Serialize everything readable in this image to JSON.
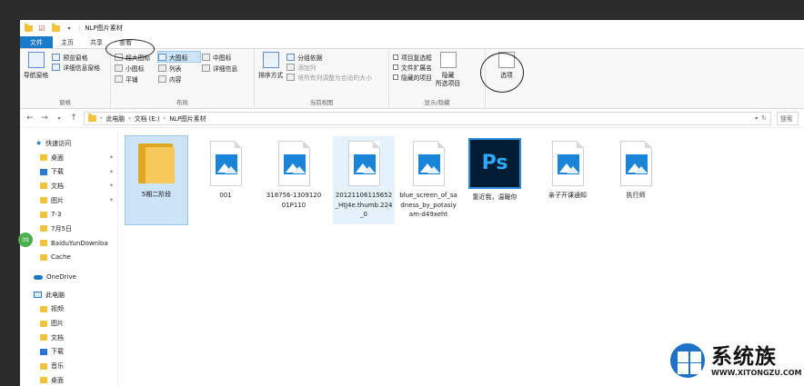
{
  "window": {
    "title": "NLP图片素材"
  },
  "tabs": [
    "文件",
    "主页",
    "共享",
    "查看"
  ],
  "ribbon": {
    "panes": {
      "nav_pane": "导航窗格",
      "preview_pane": "预览窗格",
      "details_pane": "详细信息窗格",
      "label": "窗格"
    },
    "layout": {
      "xl_icons": "超大图标",
      "large_icons": "大图标",
      "medium_icons": "中图标",
      "small_icons": "小图标",
      "list": "列表",
      "details": "详细信息",
      "tiles": "平铺",
      "content": "内容",
      "label": "布局"
    },
    "current_view": {
      "sort_by": "排序方式",
      "group_by": "分组依据",
      "add_columns": "添加列",
      "fit_columns": "将所有列调整为合适的大小",
      "label": "当前视图"
    },
    "show_hide": {
      "item_checkboxes": "项目复选框",
      "file_extensions": "文件扩展名",
      "hidden_items": "隐藏的项目",
      "hide_selected_1": "隐藏",
      "hide_selected_2": "所选项目",
      "label": "显示/隐藏"
    },
    "options": "选项"
  },
  "address": {
    "crumbs": [
      "此电脑",
      "文档 (E:)",
      "NLP图片素材"
    ],
    "search_placeholder": "搜索"
  },
  "nav": {
    "items": [
      {
        "label": "快速访问",
        "icon": "star-icon"
      },
      {
        "label": "桌面",
        "icon": "folder-icon"
      },
      {
        "label": "下载",
        "icon": "download-icon"
      },
      {
        "label": "文档",
        "icon": "folder-icon"
      },
      {
        "label": "图片",
        "icon": "folder-icon"
      },
      {
        "label": "7-3",
        "icon": "folder-icon"
      },
      {
        "label": "7月5日",
        "icon": "folder-icon"
      },
      {
        "label": "BaiduYunDownloa",
        "icon": "folder-icon"
      },
      {
        "label": "Cache",
        "icon": "folder-icon"
      },
      {
        "label": "OneDrive",
        "icon": "cloud-icon"
      },
      {
        "label": "此电脑",
        "icon": "pc-icon"
      },
      {
        "label": "视频",
        "icon": "folder-icon"
      },
      {
        "label": "图片",
        "icon": "folder-icon"
      },
      {
        "label": "文档",
        "icon": "folder-icon"
      },
      {
        "label": "下载",
        "icon": "download-icon"
      },
      {
        "label": "音乐",
        "icon": "folder-icon"
      },
      {
        "label": "桌面",
        "icon": "folder-icon"
      }
    ]
  },
  "files": [
    {
      "name": "5期二阶段",
      "type": "folder"
    },
    {
      "name": "001",
      "type": "image"
    },
    {
      "name": "318756-130912001P110",
      "type": "image"
    },
    {
      "name": "20121106115652_HtJ4e.thumb.224_0",
      "type": "image"
    },
    {
      "name": "blue_screen_of_sadness_by_potasiyam-d49xeht",
      "type": "image"
    },
    {
      "name": "靠近我，温暖你",
      "type": "psd"
    },
    {
      "name": "亲子开课通知",
      "type": "image"
    },
    {
      "name": "执行师",
      "type": "image"
    }
  ],
  "ps_glyph": "Ps",
  "badge": "39",
  "watermark": {
    "title": "系统族",
    "url": "WWW.XITONGZU.COM"
  }
}
